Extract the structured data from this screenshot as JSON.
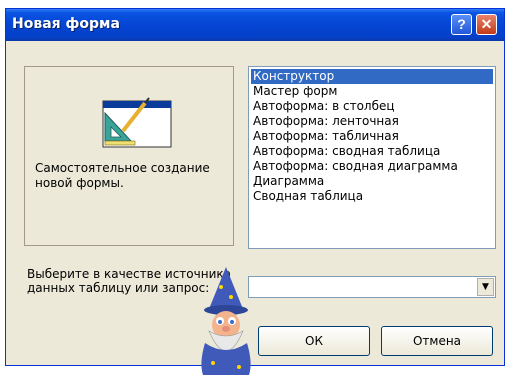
{
  "window": {
    "title": "Новая форма"
  },
  "titlebar": {
    "help_label": "?",
    "close_label": "✕"
  },
  "preview": {
    "description": "Самостоятельное создание новой формы."
  },
  "list": {
    "items": [
      "Конструктор",
      "Мастер форм",
      "Автоформа: в столбец",
      "Автоформа: ленточная",
      "Автоформа: табличная",
      "Автоформа:  сводная таблица",
      "Автоформа:  сводная диаграмма",
      "Диаграмма",
      "Сводная таблица"
    ],
    "selected": "Конструктор"
  },
  "source": {
    "label": "Выберите в качестве источника данных таблицу или запрос:",
    "value": ""
  },
  "buttons": {
    "ok": "ОК",
    "cancel": "Отмена"
  },
  "colors": {
    "title_bar": "#0545d3",
    "selection": "#316ac5",
    "dialog_bg": "#ece9d8"
  },
  "icons": [
    "form-design-icon",
    "office-assistant-wizard",
    "dropdown-arrow-icon",
    "help-icon",
    "close-icon"
  ]
}
